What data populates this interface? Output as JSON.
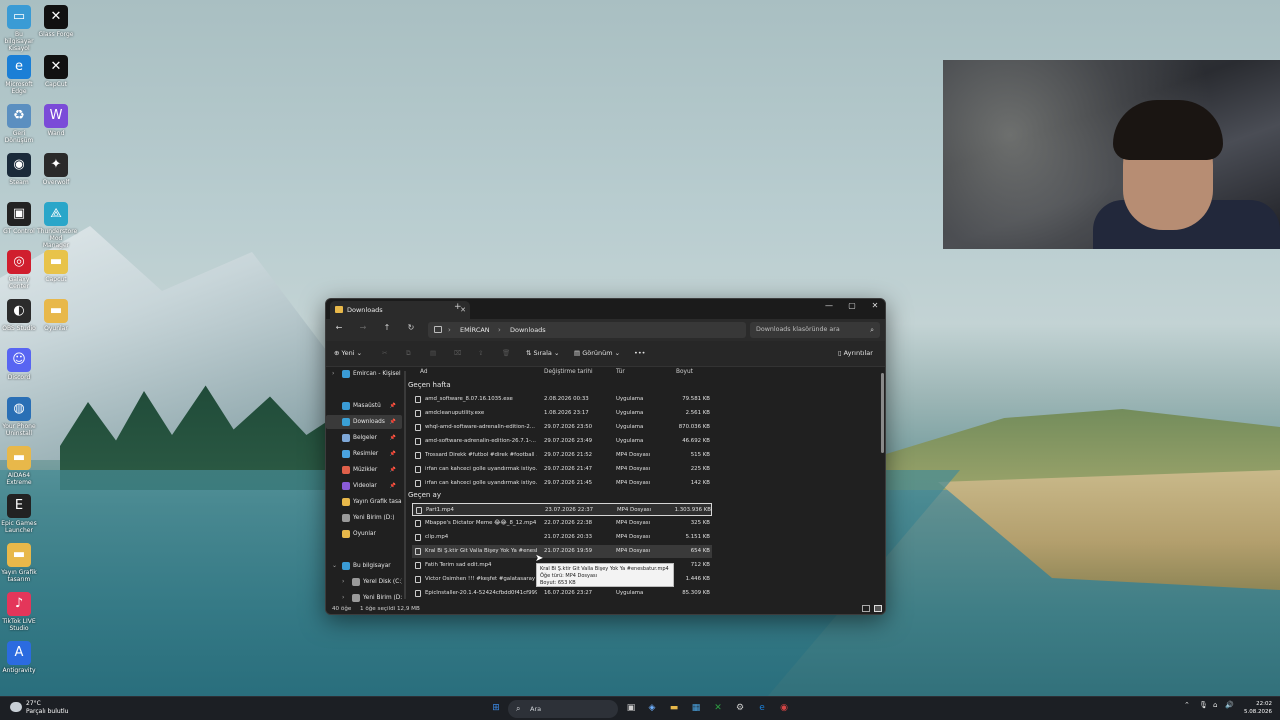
{
  "desktop": {
    "icons": [
      {
        "label": "Bu bilgisayar Kısayol",
        "glyph": "▭",
        "color": "#3a9bd5"
      },
      {
        "label": "Glass Forge",
        "glyph": "✕",
        "color": "#111111"
      },
      {
        "label": "Microsoft Edge",
        "glyph": "e",
        "color": "#1b7fd6"
      },
      {
        "label": "CapCut",
        "glyph": "✕",
        "color": "#111111"
      },
      {
        "label": "Geri Dönüşüm",
        "glyph": "♻",
        "color": "#5b8fc0"
      },
      {
        "label": "Wand",
        "glyph": "W",
        "color": "#7b4bd8"
      },
      {
        "label": "Steam",
        "glyph": "◉",
        "color": "#1a2a3a"
      },
      {
        "label": "Overwolf",
        "glyph": "✦",
        "color": "#2a2a2a"
      },
      {
        "label": "GT Control",
        "glyph": "▣",
        "color": "#222222"
      },
      {
        "label": "Thunderstore Mod Manager",
        "glyph": "⟁",
        "color": "#2aa6c9"
      },
      {
        "label": "Galaxy Center",
        "glyph": "◎",
        "color": "#d01e2e"
      },
      {
        "label": "Capcut",
        "glyph": "▬",
        "color": "#e8c34a"
      },
      {
        "label": "OBS Studio",
        "glyph": "◐",
        "color": "#2b2b2b"
      },
      {
        "label": "Oyunlar",
        "glyph": "▬",
        "color": "#e8b84a"
      },
      {
        "label": "Discord",
        "glyph": "☺",
        "color": "#5865f2"
      },
      {
        "label": "Your Phone Uninstall",
        "glyph": "◍",
        "color": "#2a6fb5"
      },
      {
        "label": "AIDA64 Extreme",
        "glyph": "▬",
        "color": "#e8b84a"
      },
      {
        "label": "Epic Games Launcher",
        "glyph": "E",
        "color": "#222222"
      },
      {
        "label": "Yayın Grafik tasarım",
        "glyph": "▬",
        "color": "#e8b84a"
      },
      {
        "label": "TikTok LIVE Studio",
        "glyph": "♪",
        "color": "#e4365a"
      },
      {
        "label": "Antigravity",
        "glyph": "A",
        "color": "#2b6be0"
      }
    ]
  },
  "explorer": {
    "tab_title": "Downloads",
    "tab_close": "✕",
    "new_tab": "+",
    "win_min": "—",
    "win_max": "▢",
    "win_close": "✕",
    "nav": {
      "back": "←",
      "forward": "→",
      "up": "↑",
      "refresh": "↻"
    },
    "breadcrumb": [
      "EMİRCAN",
      "Downloads"
    ],
    "breadcrumb_sep": "›",
    "search_placeholder": "Downloads klasöründe ara",
    "search_icon": "⌕",
    "toolbar": {
      "new": "Yeni",
      "cut_icon": "✂",
      "copy_icon": "⧉",
      "paste_icon": "▤",
      "rename_icon": "⌧",
      "share_icon": "⇪",
      "delete_icon": "🗑",
      "sort": "Sırala",
      "view": "Görünüm",
      "more": "•••",
      "details": "Ayrıntılar"
    },
    "sidebar": {
      "items": [
        {
          "label": "Emircan - Kişisel",
          "icon_color": "#3a9bd5",
          "pinned": false,
          "chev": "›"
        },
        {
          "label": "Masaüstü",
          "icon_color": "#3a9bd5",
          "pinned": true
        },
        {
          "label": "Downloads",
          "icon_color": "#3aa0d5",
          "pinned": true,
          "selected": true
        },
        {
          "label": "Belgeler",
          "icon_color": "#7fa8d8",
          "pinned": true
        },
        {
          "label": "Resimler",
          "icon_color": "#4aa3e0",
          "pinned": true
        },
        {
          "label": "Müzikler",
          "icon_color": "#e0604a",
          "pinned": true
        },
        {
          "label": "Videolar",
          "icon_color": "#8a5bd8",
          "pinned": true
        },
        {
          "label": "Yayın Grafik tasarım",
          "icon_color": "#e8b84a",
          "pinned": false
        },
        {
          "label": "Yeni Birim (D:)",
          "icon_color": "#9a9a9a",
          "pinned": false
        },
        {
          "label": "Oyunlar",
          "icon_color": "#e8b84a",
          "pinned": false
        },
        {
          "label": "Bu bilgisayar",
          "icon_color": "#3a9bd5",
          "pinned": false,
          "chev": "⌄"
        },
        {
          "label": "Yerel Disk (C:)",
          "icon_color": "#9a9a9a",
          "pinned": false,
          "chev": "›"
        },
        {
          "label": "Yeni Birim (D:)",
          "icon_color": "#9a9a9a",
          "pinned": false,
          "chev": "›"
        }
      ],
      "pin_glyph": "📌"
    },
    "columns": {
      "name": "Ad",
      "date": "Değiştirme tarihi",
      "type": "Tür",
      "size": "Boyut"
    },
    "groups": [
      {
        "title": "Geçen hafta",
        "files": [
          {
            "name": "amd_software_8.07.16.1035.exe",
            "date": "2.08.2026 00:33",
            "type": "Uygulama",
            "size": "79.581 KB"
          },
          {
            "name": "amdcleanuputility.exe",
            "date": "1.08.2026 23:17",
            "type": "Uygulama",
            "size": "2.561 KB"
          },
          {
            "name": "whql-amd-software-adrenalin-edition-2...",
            "date": "29.07.2026 23:50",
            "type": "Uygulama",
            "size": "870.036 KB"
          },
          {
            "name": "amd-software-adrenalin-edition-26.7.1-...",
            "date": "29.07.2026 23:49",
            "type": "Uygulama",
            "size": "46.692 KB"
          },
          {
            "name": "Trossard Direkk #futbol #direk #football ...",
            "date": "29.07.2026 21:52",
            "type": "MP4 Dosyası",
            "size": "515 KB"
          },
          {
            "name": "irfan can kahceci golle uyandırmak istiyo...",
            "date": "29.07.2026 21:47",
            "type": "MP4 Dosyası",
            "size": "225 KB"
          },
          {
            "name": "irfan can kahceci golle uyandırmak istiyo...",
            "date": "29.07.2026 21:45",
            "type": "MP4 Dosyası",
            "size": "142 KB"
          }
        ]
      },
      {
        "title": "Geçen ay",
        "files": [
          {
            "name": "Part1.mp4",
            "date": "23.07.2026 22:37",
            "type": "MP4 Dosyası",
            "size": "1.303.936 KB",
            "selected": true
          },
          {
            "name": "Mbappe's Dictator Meme 😂😂_8_12.mp4",
            "date": "22.07.2026 22:38",
            "type": "MP4 Dosyası",
            "size": "325 KB"
          },
          {
            "name": "clip.mp4",
            "date": "21.07.2026 20:33",
            "type": "MP4 Dosyası",
            "size": "5.151 KB"
          },
          {
            "name": "Kral Bi Ş.ktir Git Valla Bişey Yok Ya #enesb...",
            "date": "21.07.2026 19:59",
            "type": "MP4 Dosyası",
            "size": "654 KB",
            "hover": true
          },
          {
            "name": "Fatih Terim sad edit.mp4",
            "date": "",
            "type": "",
            "size": "712 KB"
          },
          {
            "name": "Victor Osimhen !!! #keşfet #galatasaray #...",
            "date": "",
            "type": "",
            "size": "1.446 KB"
          },
          {
            "name": "EpicInstaller-20.1.4-52424cfbdd0f41cf999...",
            "date": "16.07.2026 23:27",
            "type": "Uygulama",
            "size": "85.309 KB"
          }
        ]
      }
    ],
    "tooltip": {
      "line1": "Kral Bi Ş.ktir Git Valla Bişey Yok Ya #enesbatur.mp4",
      "line2": "Öğe türü: MP4 Dosyası",
      "line3": "Boyut: 653 KB"
    },
    "status": {
      "count": "40 öğe",
      "selection": "1 öğe seçildi  12,9 MB"
    }
  },
  "taskbar": {
    "weather_temp": "27°C",
    "weather_desc": "Parçalı bulutlu",
    "search_placeholder": "Ara",
    "search_icon": "⌕",
    "apps": [
      {
        "name": "start",
        "glyph": "⊞",
        "color": "#3b8bea"
      },
      {
        "name": "task-view",
        "glyph": "▣",
        "color": "#d0d0d0"
      },
      {
        "name": "copilot",
        "glyph": "◈",
        "color": "#6fb1ff"
      },
      {
        "name": "file-explorer",
        "glyph": "▬",
        "color": "#e8b84a"
      },
      {
        "name": "store",
        "glyph": "▦",
        "color": "#4aa3e0"
      },
      {
        "name": "xbox",
        "glyph": "✕",
        "color": "#2ea043"
      },
      {
        "name": "settings",
        "glyph": "⚙",
        "color": "#cfcfcf"
      },
      {
        "name": "edge",
        "glyph": "e",
        "color": "#1b7fd6"
      },
      {
        "name": "recorder",
        "glyph": "◉",
        "color": "#d64545"
      }
    ],
    "tray": {
      "chevron": "⌃",
      "mic": "🎙",
      "network": "⌂",
      "volume": "🔊"
    },
    "time": "22:02",
    "date": "5.08.2026"
  }
}
